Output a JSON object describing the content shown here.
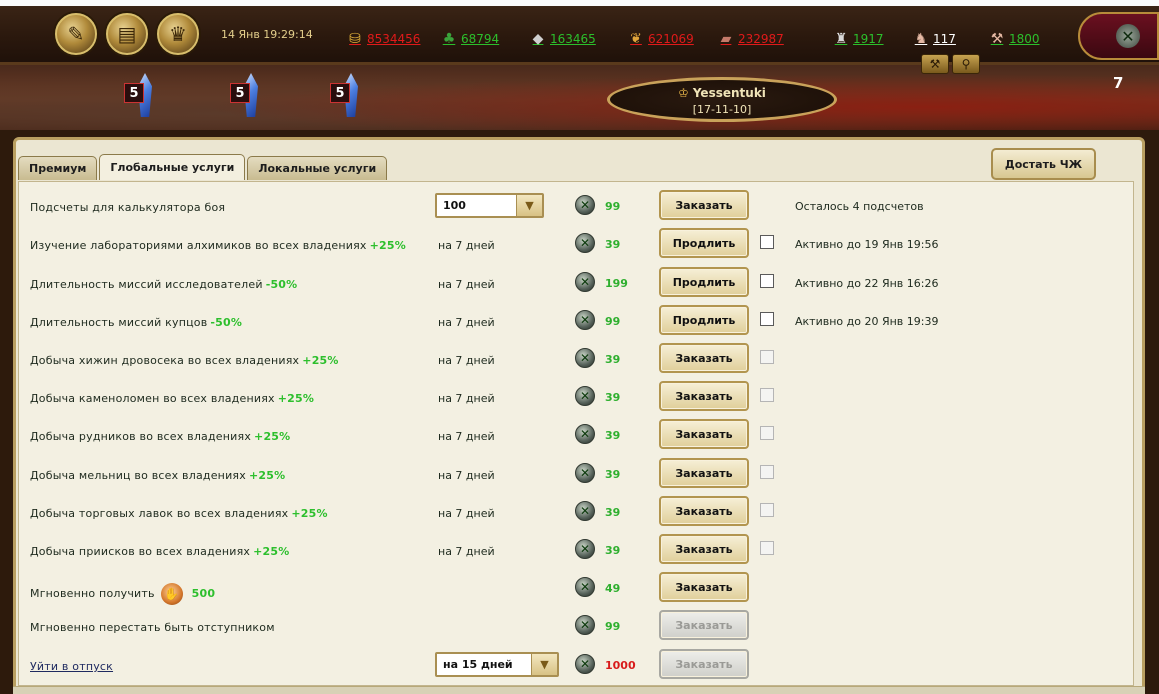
{
  "header": {
    "datetime": "14 Янв 19:29:14",
    "menu_buttons": [
      {
        "name": "quill-icon",
        "glyph": "✎"
      },
      {
        "name": "scroll-icon",
        "glyph": "▤"
      },
      {
        "name": "trophy-icon",
        "glyph": "♛"
      }
    ],
    "resources": [
      {
        "name": "gold",
        "icon": "coins-icon",
        "glyph": "⛁",
        "value": "8534456",
        "color": "red"
      },
      {
        "name": "wood",
        "icon": "tree-icon",
        "glyph": "♣",
        "value": "68794",
        "color": "green"
      },
      {
        "name": "stone",
        "icon": "stone-icon",
        "glyph": "◆",
        "value": "163465",
        "color": "green"
      },
      {
        "name": "grain",
        "icon": "wheat-icon",
        "glyph": "❦",
        "value": "621069",
        "color": "red"
      },
      {
        "name": "iron",
        "icon": "iron-icon",
        "glyph": "▰",
        "value": "232987",
        "color": "red"
      },
      {
        "name": "army",
        "icon": "soldiers-icon",
        "glyph": "♜",
        "value": "1917",
        "color": "green"
      },
      {
        "name": "heroes",
        "icon": "hero-icon",
        "glyph": "♞",
        "value": "117",
        "color": "white"
      },
      {
        "name": "workers",
        "icon": "worker-icon",
        "glyph": "⚒",
        "value": "1800",
        "color": "green"
      }
    ],
    "tools": [
      {
        "name": "hammer-icon",
        "glyph": "⚒"
      },
      {
        "name": "shovel-icon",
        "glyph": "⚲"
      }
    ],
    "side_number": "7"
  },
  "scene": {
    "crystals": [
      "5",
      "5",
      "5"
    ],
    "realm_name": "Yessentuki",
    "realm_coords": "[17-11-10]"
  },
  "tabs": [
    "Премиум",
    "Глобальные услуги",
    "Локальные услуги"
  ],
  "active_tab": 1,
  "get_button": "Достать ЧЖ",
  "rows": [
    {
      "label": "Подсчеты для калькулятора боя",
      "bonus": "",
      "period": "",
      "select": "100",
      "cost": "99",
      "action": "Заказать",
      "checkbox": "none",
      "status": "Осталось 4 подсчетов"
    },
    {
      "label": "Изучение лабораториями алхимиков во всех владениях",
      "bonus": "+25%",
      "period": "на 7 дней",
      "cost": "39",
      "action": "Продлить",
      "checkbox": "active",
      "status": "Активно до 19 Янв 19:56"
    },
    {
      "label": "Длительность миссий исследователей",
      "bonus": "-50%",
      "period": "на 7 дней",
      "cost": "199",
      "action": "Продлить",
      "checkbox": "active",
      "status": "Активно до 22 Янв 16:26"
    },
    {
      "label": "Длительность миссий купцов",
      "bonus": "-50%",
      "period": "на 7 дней",
      "cost": "99",
      "action": "Продлить",
      "checkbox": "active",
      "status": "Активно до 20 Янв 19:39"
    },
    {
      "label": "Добыча хижин дровосека во всех владениях",
      "bonus": "+25%",
      "period": "на 7 дней",
      "cost": "39",
      "action": "Заказать",
      "checkbox": "dim",
      "status": ""
    },
    {
      "label": "Добыча каменоломен во всех владениях",
      "bonus": "+25%",
      "period": "на 7 дней",
      "cost": "39",
      "action": "Заказать",
      "checkbox": "dim",
      "status": ""
    },
    {
      "label": "Добыча рудников во всех владениях",
      "bonus": "+25%",
      "period": "на 7 дней",
      "cost": "39",
      "action": "Заказать",
      "checkbox": "dim",
      "status": ""
    },
    {
      "label": "Добыча мельниц во всех владениях",
      "bonus": "+25%",
      "period": "на 7 дней",
      "cost": "39",
      "action": "Заказать",
      "checkbox": "dim",
      "status": ""
    },
    {
      "label": "Добыча торговых лавок во всех владениях",
      "bonus": "+25%",
      "period": "на 7 дней",
      "cost": "39",
      "action": "Заказать",
      "checkbox": "dim",
      "status": ""
    },
    {
      "label": "Добыча приисков во всех владениях",
      "bonus": "+25%",
      "period": "на 7 дней",
      "cost": "39",
      "action": "Заказать",
      "checkbox": "dim",
      "status": ""
    },
    {
      "label": "Мгновенно получить",
      "bonus": "500",
      "cup": true,
      "period": "",
      "cost": "49",
      "action": "Заказать",
      "checkbox": "none",
      "status": ""
    },
    {
      "label": "Мгновенно перестать быть отступником",
      "bonus": "",
      "period": "",
      "cost": "99",
      "action": "Заказать",
      "disabled": true,
      "checkbox": "none",
      "status": ""
    },
    {
      "label": "Уйти в отпуск",
      "link": true,
      "bonus": "",
      "period": "",
      "select": "на 15 дней",
      "cost": "1000",
      "cost_red": true,
      "action": "Заказать",
      "disabled": true,
      "checkbox": "none",
      "status": ""
    }
  ],
  "colors": {
    "bonus": "#2dbf2d",
    "cost_green": "#2eaf2e",
    "cost_red": "#d81b1b",
    "panel_bg": "#ebe6d2"
  }
}
